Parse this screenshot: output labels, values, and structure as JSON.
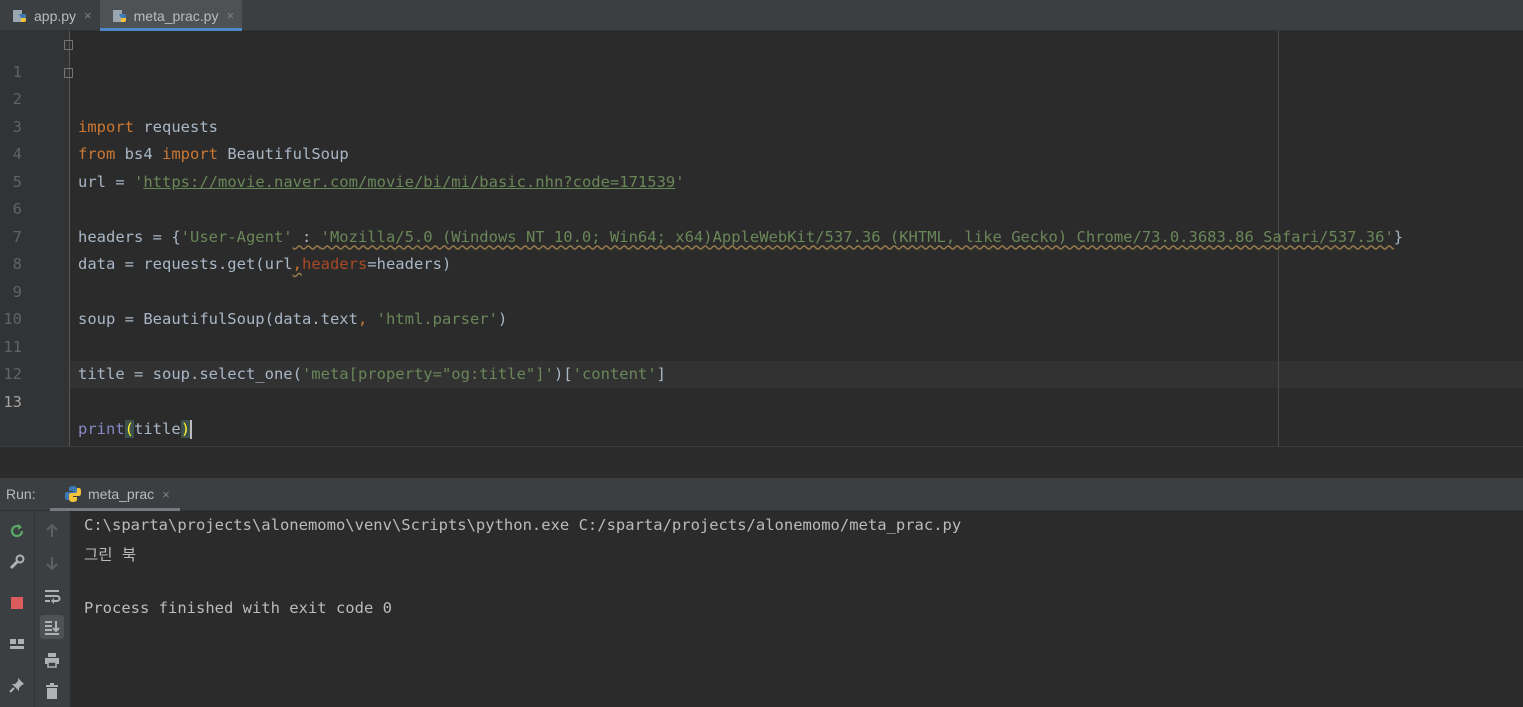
{
  "editor_tabs": [
    {
      "label": "app.py",
      "icon": "python-file-icon",
      "active": false
    },
    {
      "label": "meta_prac.py",
      "icon": "python-file-icon",
      "active": true
    }
  ],
  "close_glyph": "×",
  "code_lines": [
    {
      "num": "1"
    },
    {
      "num": "2"
    },
    {
      "num": "3"
    },
    {
      "num": "4"
    },
    {
      "num": "5"
    },
    {
      "num": "6"
    },
    {
      "num": "7"
    },
    {
      "num": "8"
    },
    {
      "num": "9"
    },
    {
      "num": "10"
    },
    {
      "num": "11"
    },
    {
      "num": "12"
    },
    {
      "num": "13"
    }
  ],
  "code": {
    "l1_kw": "import",
    "l1_rest": " requests",
    "l2_kw1": "from",
    "l2_mod": " bs4 ",
    "l2_kw2": "import",
    "l2_rest": " BeautifulSoup",
    "l4_pre": "url = ",
    "l4_q1": "'",
    "l4_url": "https://movie.naver.com/movie/bi/mi/basic.nhn?code=171539",
    "l4_q2": "'",
    "l6_pre": "headers = {",
    "l6_key": "'User-Agent'",
    "l6_colon": " : ",
    "l6_val": "'Mozilla/5.0 (Windows NT 10.0; Win64; x64)AppleWebKit/537.36 (KHTML, like Gecko) Chrome/73.0.3683.86 Safari/537.36'",
    "l6_end": "}",
    "l7_pre": "data = requests.get(url",
    "l7_comma": ",",
    "l7_param": "headers",
    "l7_rest": "=headers)",
    "l9_pre": "soup = BeautifulSoup(data.text",
    "l9_comma": ", ",
    "l9_str": "'html.parser'",
    "l9_end": ")",
    "l11_pre": "title = soup.select_one(",
    "l11_str1": "'meta[property=\"og:title\"]'",
    "l11_mid": ")[",
    "l11_str2": "'content'",
    "l11_end": "]",
    "l13_fn": "print",
    "l13_open": "(",
    "l13_arg": "title",
    "l13_close": ")"
  },
  "run_panel": {
    "label": "Run:",
    "tab_label": "meta_prac",
    "output": [
      "C:\\sparta\\projects\\alonemomo\\venv\\Scripts\\python.exe C:/sparta/projects/alonemomo/meta_prac.py",
      "그린 북",
      "",
      "Process finished with exit code 0"
    ]
  },
  "colors": {
    "keyword": "#cc7832",
    "string": "#6a8759",
    "param": "#aa4926",
    "builtin": "#8888c6",
    "accent": "#4a88c7"
  }
}
